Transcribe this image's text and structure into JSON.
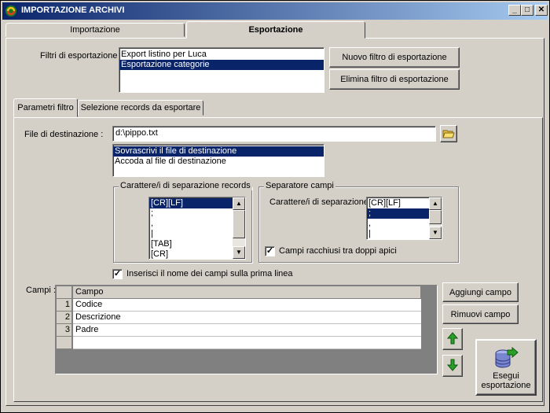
{
  "window": {
    "title": "IMPORTAZIONE ARCHIVI",
    "controls": {
      "minimize": "_",
      "maximize": "□",
      "close": "✕"
    }
  },
  "outer_tabs": [
    {
      "label": "Importazione",
      "active": false
    },
    {
      "label": "Esportazione",
      "active": true
    }
  ],
  "filters": {
    "label": "Filtri di esportazione :",
    "items": [
      {
        "label": "Export listino per Luca",
        "selected": false
      },
      {
        "label": "Esportazione categorie",
        "selected": true
      }
    ],
    "new_button": "Nuovo filtro di esportazione",
    "delete_button": "Elimina filtro di esportazione"
  },
  "inner_tabs": [
    {
      "label": "Parametri filtro",
      "active": true
    },
    {
      "label": "Selezione records da esportare",
      "active": false
    }
  ],
  "destination": {
    "label": "File di destinazione :",
    "value": "d:\\pippo.txt",
    "mode_options": [
      {
        "label": "Sovrascrivi il file di destinazione",
        "selected": true
      },
      {
        "label": "Accoda al file di destinazione",
        "selected": false
      }
    ]
  },
  "record_separator": {
    "title": "Carattere/i di separazione records",
    "items": [
      {
        "label": "[CR][LF]",
        "selected": true
      },
      {
        "label": ";",
        "selected": false
      },
      {
        "label": ",",
        "selected": false
      },
      {
        "label": "|",
        "selected": false
      },
      {
        "label": "[TAB]",
        "selected": false
      },
      {
        "label": "[CR]",
        "selected": false
      }
    ]
  },
  "field_separator": {
    "title": "Separatore campi",
    "label": "Carattere/i di separazione",
    "items": [
      {
        "label": "[CR][LF]",
        "selected": false
      },
      {
        "label": ";",
        "selected": true
      },
      {
        "label": ",",
        "selected": false
      },
      {
        "label": "|",
        "selected": false
      }
    ],
    "quotes_checkbox": {
      "label": "Campi racchiusi tra doppi apici",
      "checked": true
    }
  },
  "header_checkbox": {
    "label": "Inserisci il nome dei campi sulla prima linea",
    "checked": true
  },
  "fields": {
    "label": "Campi :",
    "column_header": "Campo",
    "rows": [
      {
        "num": "1",
        "name": "Codice"
      },
      {
        "num": "2",
        "name": "Descrizione"
      },
      {
        "num": "3",
        "name": "Padre"
      }
    ],
    "add_button": "Aggiungi campo",
    "remove_button": "Rimuovi campo",
    "execute_button_line1": "Esegui",
    "execute_button_line2": "esportazione"
  },
  "colors": {
    "selection": "#0a246a",
    "face": "#d4d0c8",
    "arrow_green": "#2aa02a"
  },
  "icons": {
    "app": "app-logo-icon",
    "browse": "folder-open-icon",
    "move_up": "arrow-up-icon",
    "move_down": "arrow-down-icon",
    "execute": "database-export-icon",
    "check": "✓"
  }
}
